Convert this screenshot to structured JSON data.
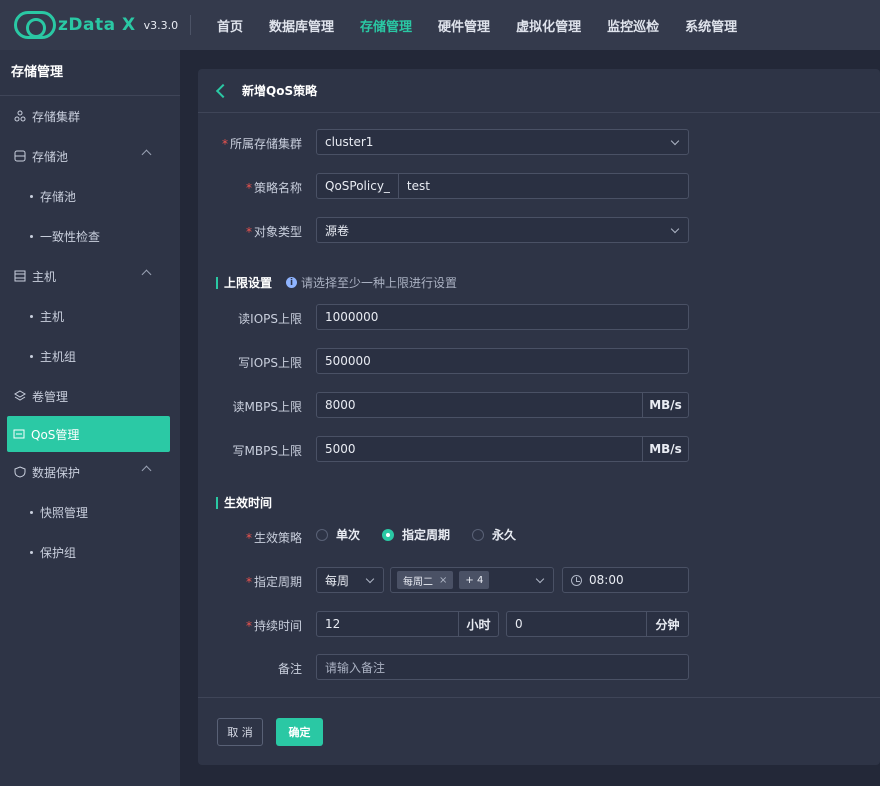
{
  "app": {
    "name": "zData X",
    "version": "v3.3.0"
  },
  "nav": [
    "首页",
    "数据库管理",
    "存储管理",
    "硬件管理",
    "虚拟化管理",
    "监控巡检",
    "系统管理"
  ],
  "sidebar": {
    "title": "存储管理",
    "items": {
      "cluster": "存储集群",
      "pool": "存储池",
      "pool_sub": "存储池",
      "consistency": "一致性检查",
      "host": "主机",
      "host_sub": "主机",
      "host_group": "主机组",
      "volume": "卷管理",
      "qos": "QoS管理",
      "protect": "数据保护",
      "snapshot": "快照管理",
      "protect_group": "保护组"
    }
  },
  "form": {
    "title": "新增QoS策略",
    "cluster": {
      "label": "所属存储集群",
      "value": "cluster1"
    },
    "name": {
      "label": "策略名称",
      "prefix": "QoSPolicy_",
      "value": "test"
    },
    "object": {
      "label": "对象类型",
      "value": "源卷"
    },
    "limits": {
      "title": "上限设置",
      "hint": "请选择至少一种上限进行设置",
      "read_iops": {
        "label": "读IOPS上限",
        "value": "1000000"
      },
      "write_iops": {
        "label": "写IOPS上限",
        "value": "500000"
      },
      "read_mbps": {
        "label": "读MBPS上限",
        "value": "8000",
        "unit": "MB/s"
      },
      "write_mbps": {
        "label": "写MBPS上限",
        "value": "5000",
        "unit": "MB/s"
      }
    },
    "time": {
      "title": "生效时间",
      "policy": {
        "label": "生效策略",
        "options": [
          "单次",
          "指定周期",
          "永久"
        ],
        "selected": "指定周期"
      },
      "period": {
        "label": "指定周期",
        "freq": "每周",
        "tag": "每周二",
        "more": "+ 4",
        "time": "08:00"
      },
      "duration": {
        "label": "持续时间",
        "hours": "12",
        "hours_unit": "小时",
        "minutes": "0",
        "minutes_unit": "分钟"
      },
      "note": {
        "label": "备注",
        "placeholder": "请输入备注"
      }
    },
    "buttons": {
      "cancel": "取 消",
      "ok": "确定"
    }
  },
  "colors": {
    "accent": "#2ac8a4",
    "required": "#f0544f"
  }
}
